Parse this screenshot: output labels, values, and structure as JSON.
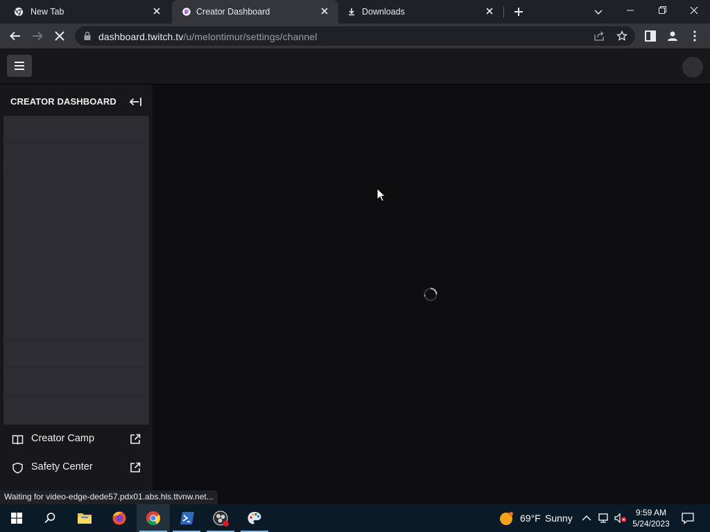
{
  "browser": {
    "tabs": [
      {
        "title": "New Tab",
        "icon": "chrome-icon"
      },
      {
        "title": "Creator Dashboard",
        "icon": "twitch-icon",
        "active": true
      },
      {
        "title": "Downloads",
        "icon": "download-icon"
      }
    ],
    "url_host": "dashboard.twitch.tv",
    "url_path": "/u/melontimur/settings/channel",
    "status_text": "Waiting for video-edge-dede57.pdx01.abs.hls.ttvnw.net..."
  },
  "dashboard": {
    "sidebar_title": "CREATOR DASHBOARD",
    "links": [
      {
        "label": "Creator Camp",
        "icon": "book-icon"
      },
      {
        "label": "Safety Center",
        "icon": "shield-icon"
      }
    ],
    "main_loading": true
  },
  "taskbar": {
    "apps": [
      "start",
      "search",
      "file-explorer",
      "firefox",
      "chrome",
      "powershell",
      "obs",
      "paint"
    ],
    "active_app": "chrome",
    "weather": {
      "temp": "69°F",
      "condition": "Sunny"
    },
    "time": "9:59 AM",
    "date": "5/24/2023"
  },
  "colors": {
    "chrome_frame": "#202124",
    "chrome_toolbar": "#35363a",
    "twitch_nav": "#18181b",
    "twitch_bg": "#0e0e10",
    "skeleton": "#2c2c31",
    "taskbar": "#0a1a26"
  }
}
